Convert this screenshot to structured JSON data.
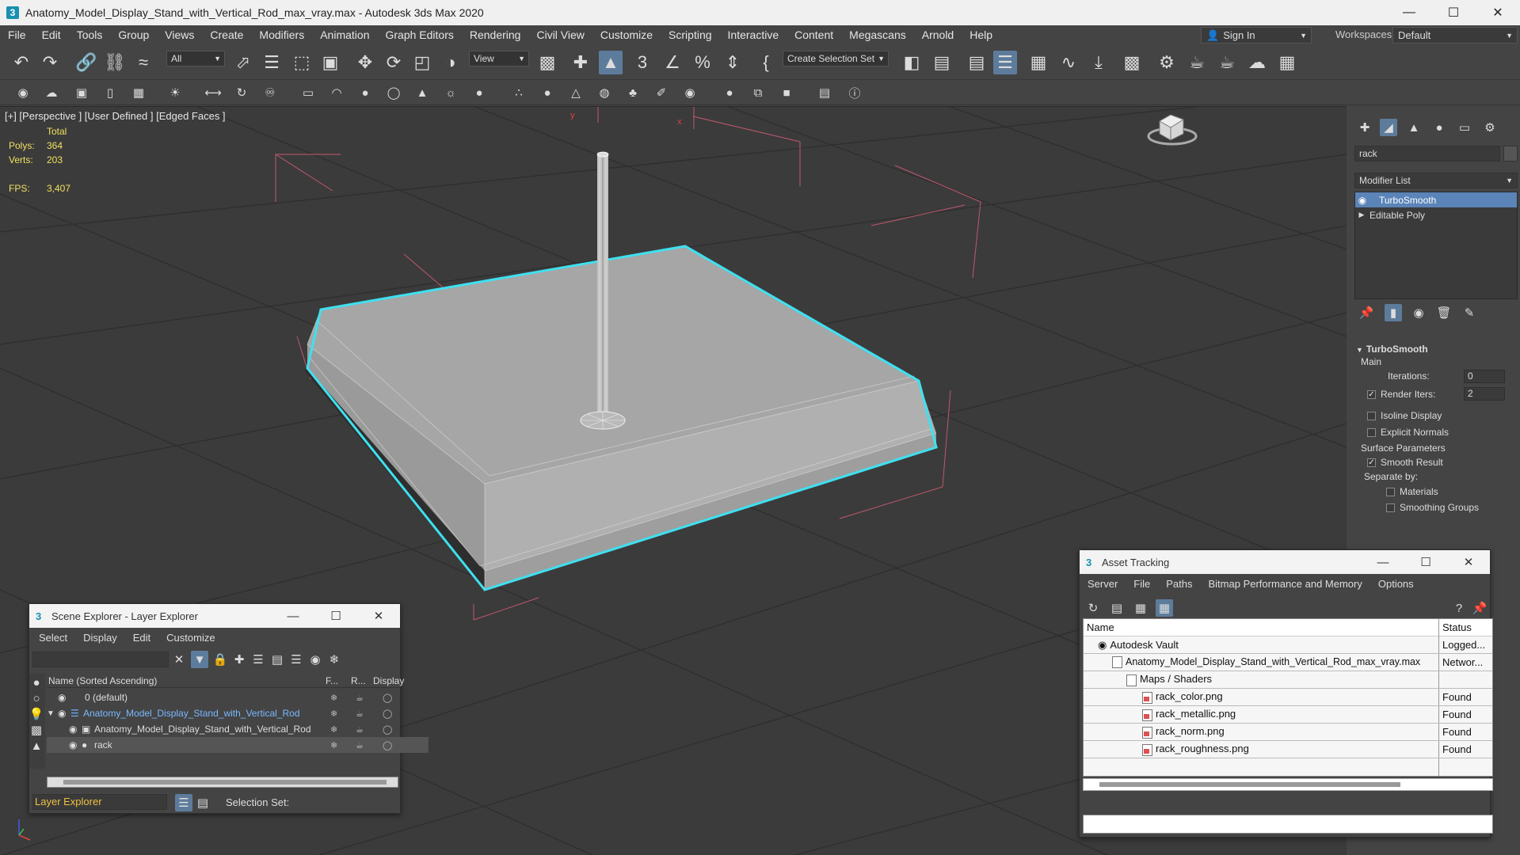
{
  "window": {
    "title": "Anatomy_Model_Display_Stand_with_Vertical_Rod_max_vray.max - Autodesk 3ds Max 2020",
    "app_icon": "3"
  },
  "menu": [
    "File",
    "Edit",
    "Tools",
    "Group",
    "Views",
    "Create",
    "Modifiers",
    "Animation",
    "Graph Editors",
    "Rendering",
    "Civil View",
    "Customize",
    "Scripting",
    "Interactive",
    "Content",
    "Megascans",
    "Arnold",
    "Help"
  ],
  "account": {
    "sign_in": "Sign In",
    "workspaces_label": "Workspaces:",
    "workspace": "Default"
  },
  "toolbar": {
    "filter": "All",
    "ref_coord": "View",
    "selection_set": "Create Selection Set"
  },
  "viewport": {
    "label": "[+] [Perspective ] [User Defined ] [Edged Faces ]",
    "stats": {
      "header": "Total",
      "polys_label": "Polys:",
      "polys": "364",
      "verts_label": "Verts:",
      "verts": "203",
      "fps_label": "FPS:",
      "fps": "3,407"
    },
    "axis_labels": {
      "y": "y",
      "x": "x"
    }
  },
  "command_panel": {
    "search": "rack",
    "modifier_list": "Modifier List",
    "stack": [
      "TurboSmooth",
      "Editable Poly"
    ],
    "rollout": {
      "title": "TurboSmooth",
      "main": "Main",
      "iterations_label": "Iterations:",
      "iterations": "0",
      "render_iters_label": "Render Iters:",
      "render_iters": "2",
      "isoline": "Isoline Display",
      "explicit_normals": "Explicit Normals",
      "surface_params": "Surface Parameters",
      "smooth_result": "Smooth Result",
      "separate_by": "Separate by:",
      "materials": "Materials",
      "smoothing_groups": "Smoothing Groups"
    }
  },
  "scene_explorer": {
    "title": "Scene Explorer - Layer Explorer",
    "menu": [
      "Select",
      "Display",
      "Edit",
      "Customize"
    ],
    "columns": {
      "name": "Name (Sorted Ascending)",
      "f": "F...",
      "r": "R...",
      "display": "Display"
    },
    "rows": [
      {
        "name": "0 (default)"
      },
      {
        "name": "Anatomy_Model_Display_Stand_with_Vertical_Rod"
      },
      {
        "name": "Anatomy_Model_Display_Stand_with_Vertical_Rod"
      },
      {
        "name": "rack"
      }
    ],
    "footer_layer": "Layer Explorer",
    "selection_set": "Selection Set:"
  },
  "asset_tracking": {
    "title": "Asset Tracking",
    "menu": [
      "Server",
      "File",
      "Paths",
      "Bitmap Performance and Memory",
      "Options"
    ],
    "columns": {
      "name": "Name",
      "status": "Status"
    },
    "rows": [
      {
        "name": "Autodesk Vault",
        "status": "Logged..."
      },
      {
        "name": "Anatomy_Model_Display_Stand_with_Vertical_Rod_max_vray.max",
        "status": "Networ..."
      },
      {
        "name": "Maps / Shaders",
        "status": ""
      },
      {
        "name": "rack_color.png",
        "status": "Found"
      },
      {
        "name": "rack_metallic.png",
        "status": "Found"
      },
      {
        "name": "rack_norm.png",
        "status": "Found"
      },
      {
        "name": "rack_roughness.png",
        "status": "Found"
      }
    ]
  },
  "colors": {
    "selection_outline": "#3fe0f0",
    "stats_text": "#f0e060",
    "active_blue": "#5b84b8"
  }
}
